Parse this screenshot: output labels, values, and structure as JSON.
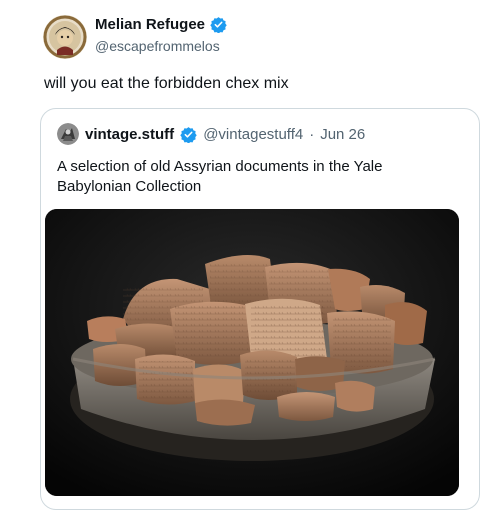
{
  "post": {
    "author_name": "Melian Refugee",
    "author_handle": "@escapefrommelos",
    "text": "will you eat the forbidden chex mix",
    "verified_icon": "verified-badge-icon"
  },
  "quoted": {
    "author_name": "vintage.stuff",
    "author_handle": "@vintagestuff4",
    "separator": "·",
    "date": "Jun 26",
    "text": "A selection of old Assyrian documents in the Yale Babylonian Collection",
    "verified_icon": "verified-badge-icon"
  },
  "colors": {
    "verified": "#1d9bf0",
    "secondary_text": "#536471",
    "border": "#cfd9de"
  }
}
